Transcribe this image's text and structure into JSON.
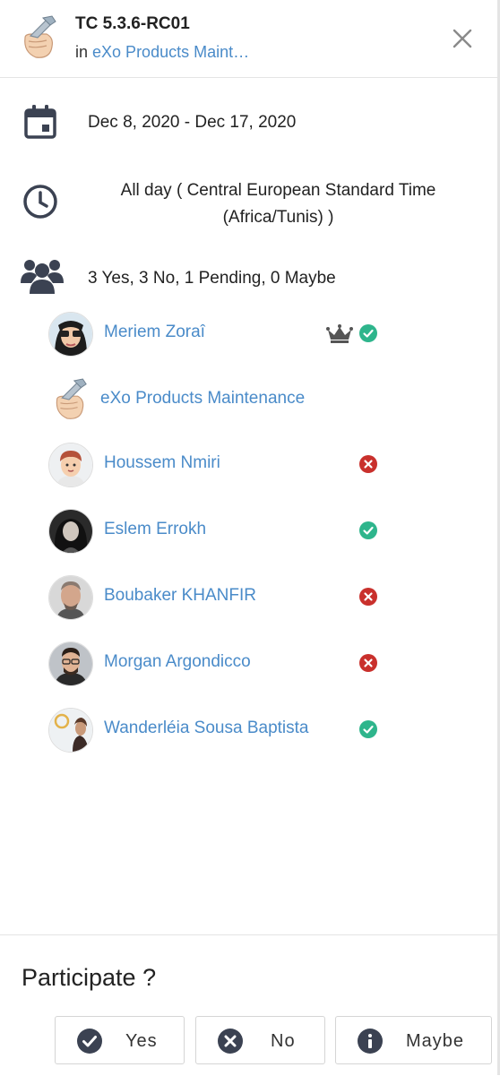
{
  "header": {
    "title": "TC 5.3.6-RC01",
    "in_prefix": "in",
    "space_link": "eXo Products Maint…"
  },
  "event": {
    "dates": "Dec 8, 2020 - Dec 17, 2020",
    "time_line1": "All day ( Central European Standard Time",
    "time_line2": "(Africa/Tunis) )",
    "summary": "3 Yes, 3 No, 1 Pending, 0 Maybe"
  },
  "participants": [
    {
      "name": "Meriem Zoraî",
      "status": "yes",
      "organizer": true
    },
    {
      "name": "eXo Products Maintenance",
      "status": "none",
      "organizer": false
    },
    {
      "name": "Houssem Nmiri",
      "status": "no",
      "organizer": false
    },
    {
      "name": "Eslem Errokh",
      "status": "yes",
      "organizer": false
    },
    {
      "name": "Boubaker KHANFIR",
      "status": "no",
      "organizer": false
    },
    {
      "name": "Morgan Argondicco",
      "status": "no",
      "organizer": false
    },
    {
      "name": "Wanderléia Sousa Baptista",
      "status": "yes",
      "organizer": false
    }
  ],
  "footer": {
    "title": "Participate ?",
    "yes_label": "Yes",
    "no_label": "No",
    "maybe_label": "Maybe"
  },
  "icons": {
    "close": "close-icon",
    "calendar": "calendar-icon",
    "clock": "clock-icon",
    "people": "people-icon",
    "crown": "crown-icon",
    "yes": "check-circle-icon",
    "no": "x-circle-icon",
    "maybe": "info-circle-icon"
  },
  "colors": {
    "link": "#4a8bc9",
    "yes": "#2eb58c",
    "no": "#c9302c",
    "icon": "#3b4252"
  }
}
